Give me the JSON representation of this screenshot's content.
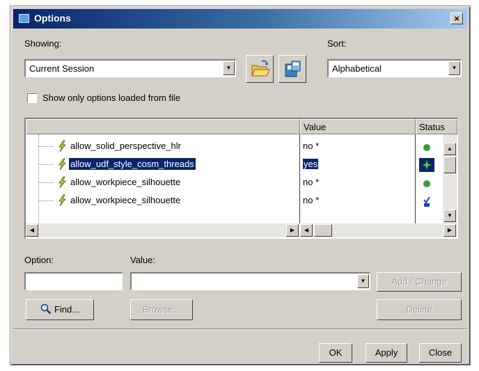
{
  "window": {
    "title": "Options",
    "close_glyph": "×",
    "icon": "options-window-icon"
  },
  "showing": {
    "label": "Showing:",
    "selected": "Current Session"
  },
  "sort": {
    "label": "Sort:",
    "selected": "Alphabetical"
  },
  "toolbar": {
    "open_icon": "open-folder-icon",
    "save_icon": "save-config-icon"
  },
  "filter_checkbox": {
    "label": "Show only options loaded from file",
    "checked": false
  },
  "table": {
    "columns": {
      "name": "",
      "value": "Value",
      "status": "Status"
    },
    "rows": [
      {
        "name": "allow_solid_perspective_hlr",
        "value": "no *",
        "status": "green-dot-icon",
        "selected": false
      },
      {
        "name": "allow_udf_style_cosm_threads",
        "value": "yes",
        "status": "green-star-icon",
        "selected": true
      },
      {
        "name": "allow_workpiece_silhouette",
        "value": "no *",
        "status": "green-dot-icon",
        "selected": false
      },
      {
        "name": "allow_workpiece_silhouette",
        "value": "no *",
        "status": "blue-check-icon",
        "selected": false
      }
    ]
  },
  "option_field": {
    "label": "Option:",
    "value": ""
  },
  "value_field": {
    "label": "Value:",
    "value": ""
  },
  "buttons": {
    "find": "Find...",
    "browse": "Browse...",
    "add_change": "Add / Change",
    "delete": "Delete",
    "ok": "OK",
    "apply": "Apply",
    "close": "Close"
  },
  "colors": {
    "selection": "#0a246a",
    "dialog_bg": "#d4d0c8",
    "titlebar": "#0a246a"
  }
}
